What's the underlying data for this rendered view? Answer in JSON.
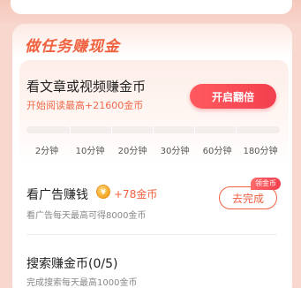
{
  "top_tabs": [
    {
      "label": "..."
    },
    {
      "label": "..."
    },
    {
      "label": "..."
    },
    {
      "label": "..."
    }
  ],
  "section": {
    "title": "做任务赚现金"
  },
  "reading_task": {
    "title": "看文章或视频赚金币",
    "subtitle": "开始阅读最高+21600金币",
    "button_label": "开启翻倍",
    "progress_fraction": 0,
    "milestones": [
      "2分钟",
      "10分钟",
      "20分钟",
      "30分钟",
      "60分钟",
      "180分钟"
    ]
  },
  "ad_task": {
    "title": "看广告赚钱",
    "coin_icon": "coin-icon",
    "reward": "+78金币",
    "subtitle": "看广告每天最高可得8000金币",
    "button_label": "去完成",
    "badge": "领金币"
  },
  "search_task": {
    "title": "搜索赚金币(0/5)",
    "subtitle": "完成搜索每天最高1000金币"
  },
  "colors": {
    "accent": "#f0613f",
    "button_red": "#f2404e",
    "background": "#f8d7cf"
  }
}
